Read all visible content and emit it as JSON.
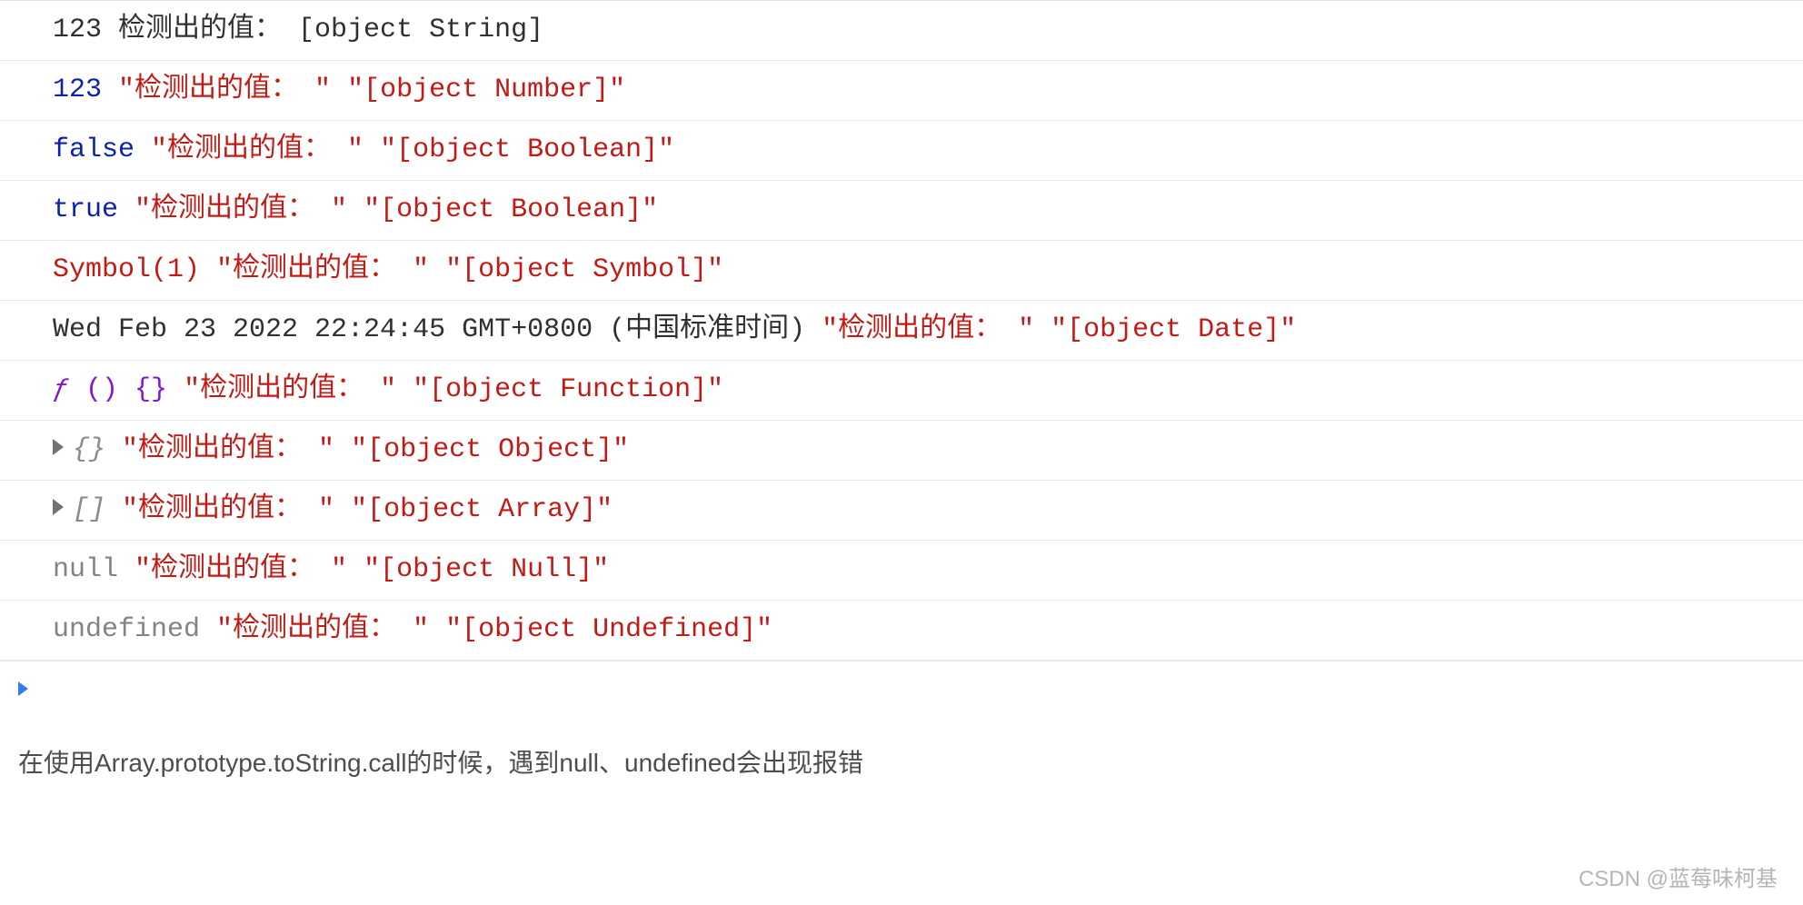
{
  "console": {
    "label_quoted": "\"检测出的值： \"",
    "label_plain": "检测出的值： ",
    "rows": [
      {
        "kind": "plain",
        "value": "123",
        "result": "[object String]"
      },
      {
        "kind": "number",
        "value": "123",
        "result": "\"[object Number]\""
      },
      {
        "kind": "bool",
        "value": "false",
        "result": "\"[object Boolean]\""
      },
      {
        "kind": "bool",
        "value": "true",
        "result": "\"[object Boolean]\""
      },
      {
        "kind": "symbol",
        "value": "Symbol(1)",
        "result": "\"[object Symbol]\""
      },
      {
        "kind": "date",
        "value": "Wed Feb 23 2022 22:24:45 GMT+0800 (中国标准时间)",
        "result": "\"[object Date]\""
      },
      {
        "kind": "func",
        "f": "ƒ",
        "value": " () {}",
        "result": "\"[object Function]\""
      },
      {
        "kind": "obj",
        "value": "{}",
        "result": "\"[object Object]\""
      },
      {
        "kind": "arr",
        "value": "[]",
        "result": "\"[object Array]\""
      },
      {
        "kind": "null",
        "value": "null",
        "result": "\"[object Null]\""
      },
      {
        "kind": "undef",
        "value": "undefined",
        "result": "\"[object Undefined]\""
      }
    ]
  },
  "article": {
    "text": "在使用Array.prototype.toString.call的时候，遇到null、undefined会出现报错"
  },
  "watermark": {
    "text": "CSDN @蓝莓味柯基"
  }
}
